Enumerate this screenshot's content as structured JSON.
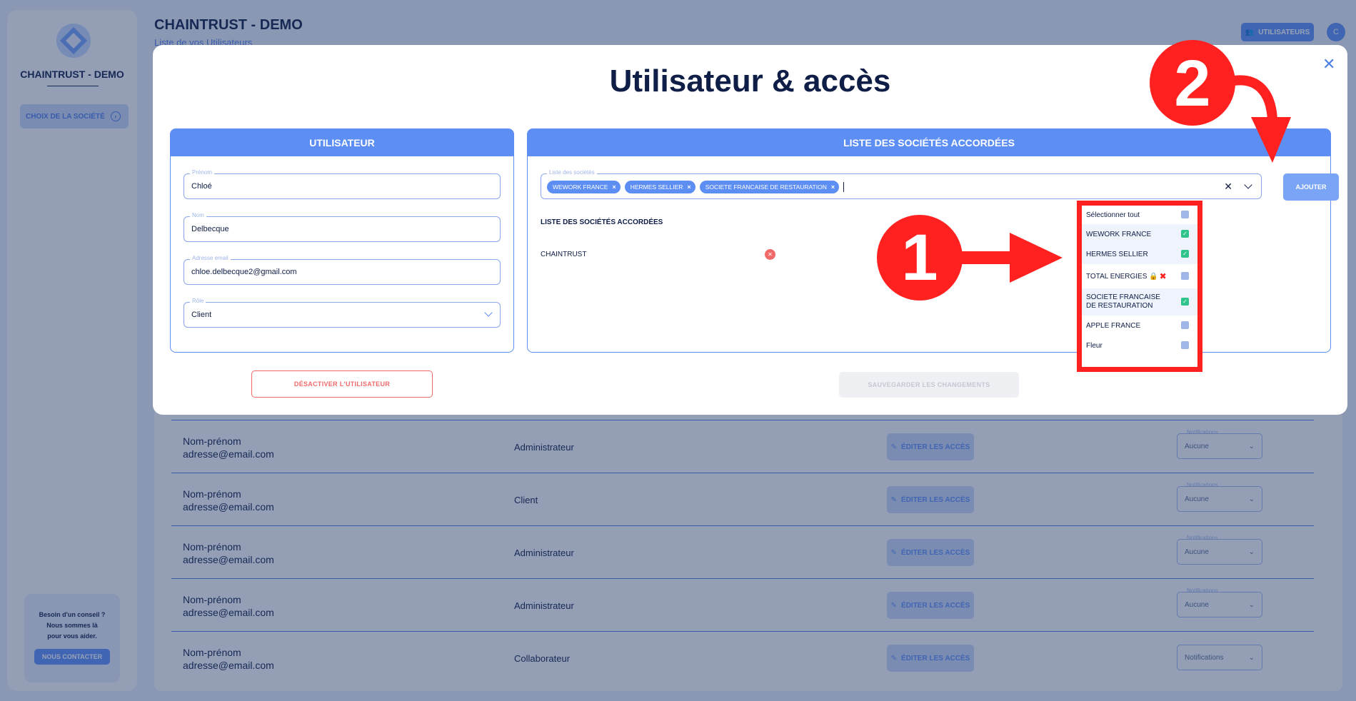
{
  "app": {
    "brand": "CHAINTRUST - DEMO",
    "page_title": "CHAINTRUST - DEMO",
    "page_subtitle": "Liste de vos Utilisateurs",
    "company_button": "CHOIX DE LA SOCIÉTÉ",
    "users_button": "UTILISATEURS",
    "avatar_initial": "C",
    "help_text_1": "Besoin d'un conseil ?",
    "help_text_2": "Nous sommes là",
    "help_text_3": "pour vous aider.",
    "help_button": "NOUS CONTACTER"
  },
  "users": [
    {
      "name": "Nom-prénom",
      "email": "adresse@email.com",
      "role": "Administrateur",
      "edit": "ÉDITER LES ACCÈS",
      "notif_label": "Notifications",
      "notif_value": "Aucune"
    },
    {
      "name": "Nom-prénom",
      "email": "adresse@email.com",
      "role": "Client",
      "edit": "ÉDITER LES ACCÈS",
      "notif_label": "Notifications",
      "notif_value": "Aucune"
    },
    {
      "name": "Nom-prénom",
      "email": "adresse@email.com",
      "role": "Administrateur",
      "edit": "ÉDITER LES ACCÈS",
      "notif_label": "Notifications",
      "notif_value": "Aucune"
    },
    {
      "name": "Nom-prénom",
      "email": "adresse@email.com",
      "role": "Administrateur",
      "edit": "ÉDITER LES ACCÈS",
      "notif_label": "Notifications",
      "notif_value": "Aucune"
    },
    {
      "name": "Nom-prénom",
      "email": "adresse@email.com",
      "role": "Collaborateur",
      "edit": "ÉDITER LES ACCÈS",
      "notif_label": "",
      "notif_value": "Notifications"
    }
  ],
  "modal": {
    "title": "Utilisateur & accès",
    "close": "✕",
    "user_panel": {
      "header": "UTILISATEUR",
      "firstname_label": "Prénom",
      "firstname_value": "Chloé",
      "lastname_label": "Nom",
      "lastname_value": "Delbecque",
      "email_label": "Adresse email",
      "email_value": "chloe.delbecque2@gmail.com",
      "role_label": "Rôle",
      "role_value": "Client"
    },
    "companies_panel": {
      "header": "LISTE DES SOCIÉTÉS ACCORDÉES",
      "select_label": "Liste des sociétés",
      "chips": [
        "WEWORK FRANCE",
        "HERMES SELLIER",
        "SOCIETE FRANCAISE DE RESTAURATION"
      ],
      "clear": "✕",
      "add_button": "AJOUTER",
      "list_title": "LISTE DES SOCIÉTÉS ACCORDÉES",
      "granted": [
        "CHAINTRUST"
      ],
      "remove_icon": "✕"
    },
    "dropdown": [
      {
        "label": "Sélectionner tout",
        "checked": false
      },
      {
        "label": "WEWORK FRANCE",
        "checked": true
      },
      {
        "label": "HERMES SELLIER",
        "checked": true
      },
      {
        "label": "TOTAL ENERGIES 🔒",
        "checked": false,
        "locked": true
      },
      {
        "label": "SOCIETE FRANCAISE DE RESTAURATION",
        "checked": true
      },
      {
        "label": "APPLE FRANCE",
        "checked": false
      },
      {
        "label": "Fleur",
        "checked": false
      }
    ],
    "deactivate_button": "DÉSACTIVER L'UTILISATEUR",
    "save_button": "SAUVEGARDER LES CHANGEMENTS"
  },
  "annotations": {
    "step1": "1",
    "step2": "2",
    "color": "#ff2020"
  },
  "colors": {
    "accent": "#5d8ef4",
    "navy": "#0f1e46",
    "danger": "#f06a6a",
    "check": "#2fc48c"
  }
}
